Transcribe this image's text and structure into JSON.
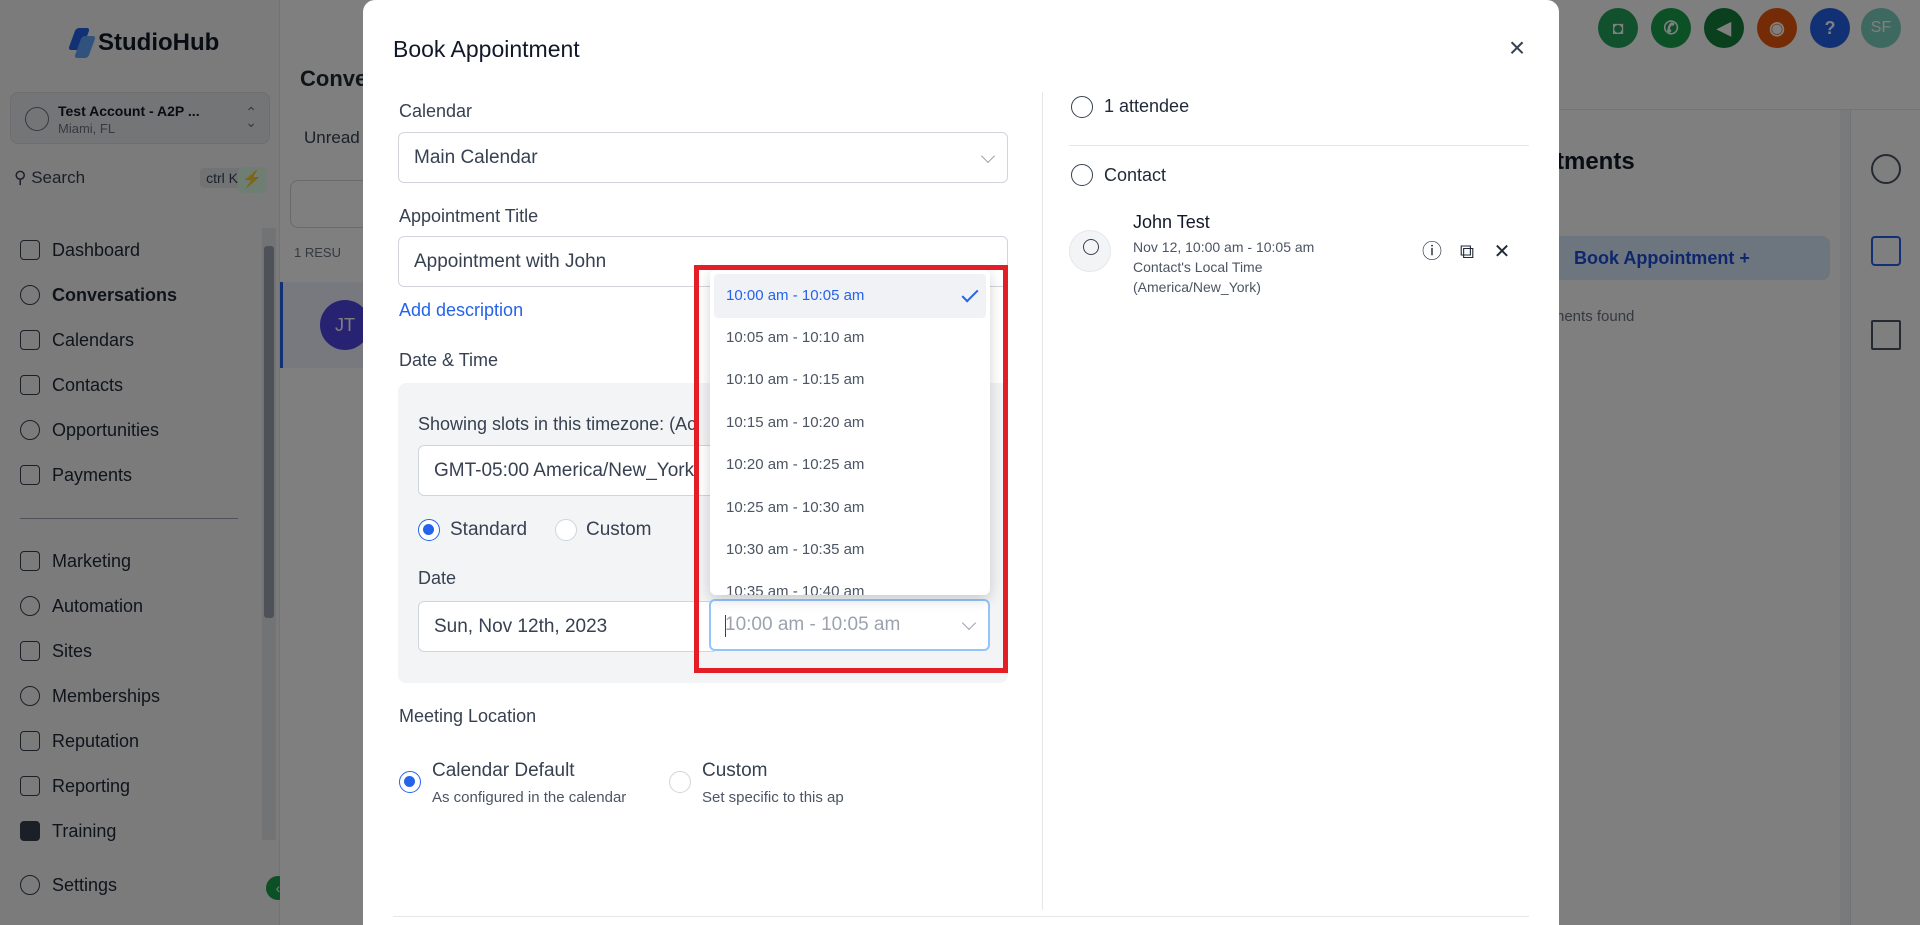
{
  "app": {
    "logo": "StudioHub",
    "account": {
      "name": "Test Account - A2P ...",
      "location": "Miami, FL"
    },
    "search": {
      "label": "Search",
      "shortcut": "ctrl K"
    },
    "nav": [
      {
        "label": "Dashboard"
      },
      {
        "label": "Conversations"
      },
      {
        "label": "Calendars"
      },
      {
        "label": "Contacts"
      },
      {
        "label": "Opportunities"
      },
      {
        "label": "Payments"
      },
      {
        "label": "Marketing"
      },
      {
        "label": "Automation"
      },
      {
        "label": "Sites"
      },
      {
        "label": "Memberships"
      },
      {
        "label": "Reputation"
      },
      {
        "label": "Reporting"
      },
      {
        "label": "Training"
      },
      {
        "label": "Settings"
      }
    ],
    "page_title": "Conve",
    "tab_unread": "Unread",
    "results": "1 RESU",
    "avatar_initials": "JT",
    "right_panel": {
      "title": "tments",
      "book_label": "Book Appointment",
      "none": "nents found"
    },
    "user_initials": "SF"
  },
  "modal": {
    "title": "Book Appointment",
    "calendar": {
      "label": "Calendar",
      "value": "Main Calendar"
    },
    "appointment_title": {
      "label": "Appointment Title",
      "value": "Appointment with John"
    },
    "add_description": "Add description",
    "datetime": {
      "label": "Date & Time",
      "timezone_label": "Showing slots in this timezone: (Ac",
      "timezone_value": "GMT-05:00 America/New_York",
      "standard": "Standard",
      "custom": "Custom",
      "date_label": "Date",
      "date_value": "Sun, Nov 12th, 2023",
      "time_placeholder": "10:00 am - 10:05 am"
    },
    "time_options": [
      {
        "label": "10:00 am - 10:05 am",
        "selected": true
      },
      {
        "label": "10:05 am - 10:10 am",
        "selected": false
      },
      {
        "label": "10:10 am - 10:15 am",
        "selected": false
      },
      {
        "label": "10:15 am - 10:20 am",
        "selected": false
      },
      {
        "label": "10:20 am - 10:25 am",
        "selected": false
      },
      {
        "label": "10:25 am - 10:30 am",
        "selected": false
      },
      {
        "label": "10:30 am - 10:35 am",
        "selected": false
      },
      {
        "label": "10:35 am - 10:40 am",
        "selected": false
      }
    ],
    "meeting_location": {
      "label": "Meeting Location",
      "default_title": "Calendar Default",
      "default_sub": "As configured in the calendar",
      "custom_title": "Custom",
      "custom_sub": "Set specific to this ap"
    },
    "attendees": {
      "count_label": "1 attendee",
      "section_label": "Contact",
      "contact_name": "John Test",
      "contact_time": "Nov 12, 10:00 am - 10:05 am",
      "local_time_label": "Contact's Local Time",
      "local_timezone": "(America/New_York)"
    }
  },
  "colors": {
    "accent": "#2563eb",
    "highlight": "#e41e26"
  }
}
